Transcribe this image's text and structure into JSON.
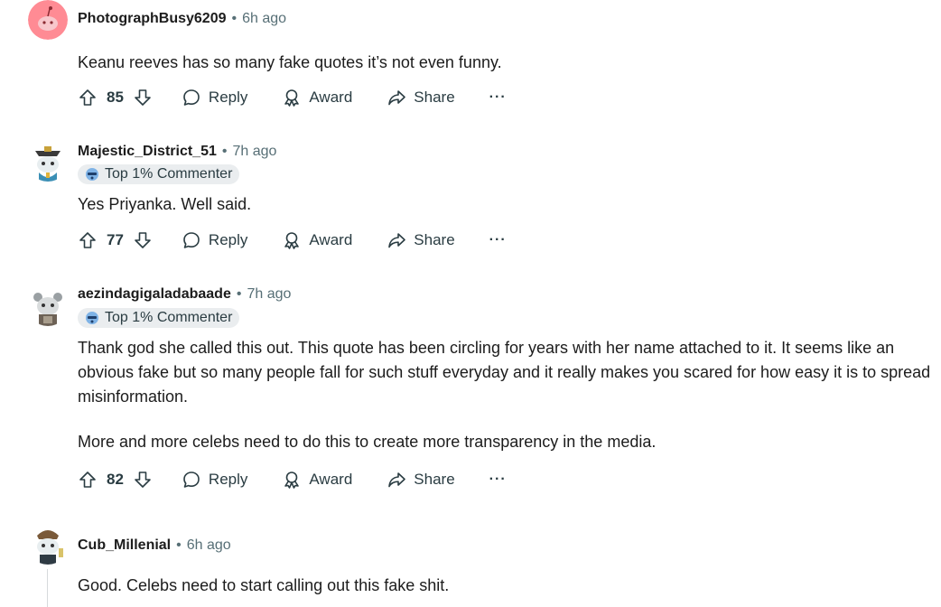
{
  "comments": [
    {
      "username": "PhotographBusy6209",
      "time": "6h ago",
      "badge": null,
      "paragraphs": [
        "Keanu reeves has so many fake quotes it’s not even funny."
      ],
      "votes": "85"
    },
    {
      "username": "Majestic_District_51",
      "time": "7h ago",
      "badge": "Top 1% Commenter",
      "paragraphs": [
        "Yes Priyanka. Well said."
      ],
      "votes": "77"
    },
    {
      "username": "aezindagigaladabaade",
      "time": "7h ago",
      "badge": "Top 1% Commenter",
      "paragraphs": [
        "Thank god she called this out. This quote has been circling for years with her name attached to it. It seems like an obvious fake but so many people fall for such stuff everyday and it really makes you scared for how easy it is to spread misinformation.",
        "More and more celebs need to do this to create more transparency in the media."
      ],
      "votes": "82"
    },
    {
      "username": "Cub_Millenial",
      "time": "6h ago",
      "badge": null,
      "paragraphs": [
        "Good. Celebs need to start calling out this fake shit."
      ],
      "votes": null
    }
  ],
  "actions": {
    "reply": "Reply",
    "award": "Award",
    "share": "Share",
    "more": "···"
  },
  "separator": "•",
  "colors": {
    "text": "#1c1c1c",
    "meta": "#576f76",
    "badge_bg": "#eaedef",
    "avatar_pink": "#ff8b94"
  }
}
